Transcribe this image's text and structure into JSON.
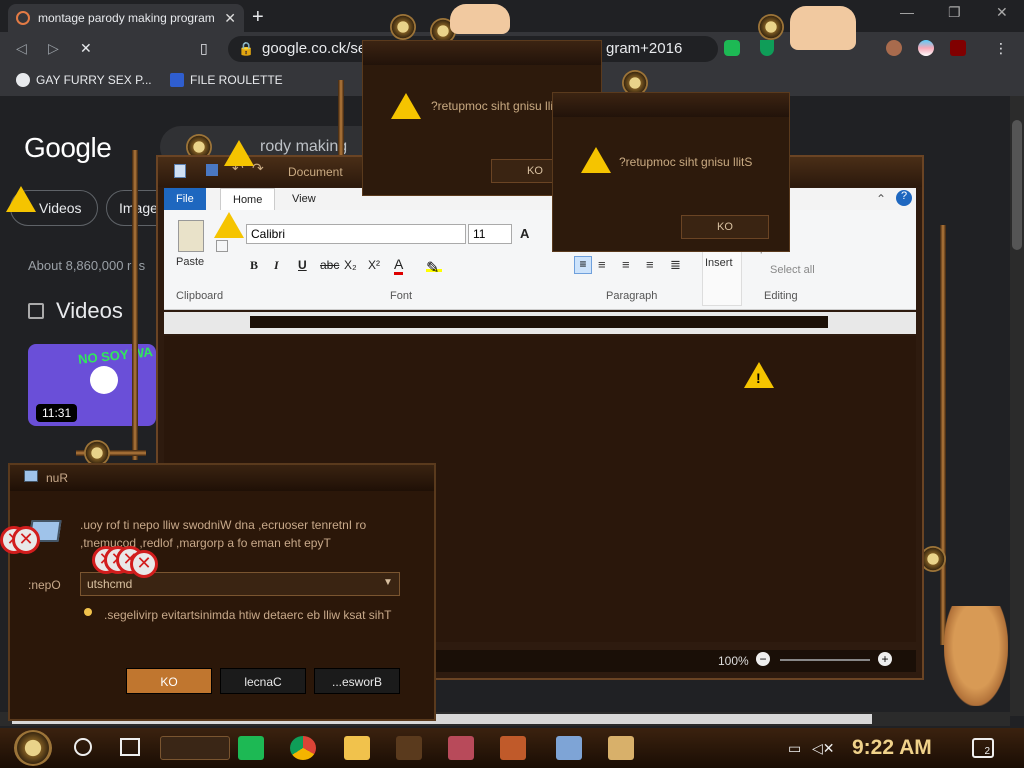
{
  "browser": {
    "tab_title": "montage parody making program",
    "new_tab": "+",
    "url": "google.co.ck/se",
    "url_tail": "gram+2016",
    "bookmarks": [
      {
        "label": "GAY FURRY SEX P..."
      },
      {
        "label": "FILE ROULETTE"
      }
    ]
  },
  "google": {
    "logo": "Google",
    "query": "rody making program 2016",
    "chips": [
      "Videos",
      "Images"
    ],
    "about": "About 8,860,000 res",
    "videos_heading": "Videos",
    "video_duration": "11:31",
    "video_overlay": "NO SOY WA"
  },
  "wordpad": {
    "title": "Document",
    "tabs": [
      "File",
      "Home",
      "View"
    ],
    "font_name": "Calibri",
    "font_size": "11",
    "format_buttons": [
      "B",
      "I",
      "U",
      "abc",
      "X₂",
      "X²"
    ],
    "groups": {
      "clipboard": "Clipboard",
      "font": "Font",
      "paragraph": "Paragraph",
      "editing": "Editing"
    },
    "paste_label": "Paste",
    "insert_label": "Insert",
    "replace_label": "place",
    "select_all_label": "Select all",
    "zoom": "100%"
  },
  "run_dialog": {
    "title": "nuR",
    "desc_line1": ".uoy rof ti nepo lliw swodniW dna ,ecruoser tenretnI ro",
    "desc_line2": ",tnemucod ,redlof ,margorp a fo eman eht epyT",
    "open_label": ":nepO",
    "input_value": "utshcmd",
    "admin_note": ".segelivirp evitartsinimda htiw detaerc eb lliw ksat sihT",
    "buttons": {
      "ok": "KO",
      "cancel": "lecnaC",
      "browse": "...esworB"
    }
  },
  "message_boxes": [
    {
      "text": "?retupmoc siht gnisu llit",
      "button": "KO"
    },
    {
      "text": "?retupmoc siht gnisu llitS",
      "button": "KO"
    }
  ],
  "taskbar": {
    "clock": "9:22 AM",
    "notification_count": "2"
  },
  "colors": {
    "brass": "#b57b3c",
    "dark_wood": "#2b1709",
    "text_brass": "#c9aa82",
    "ribbon_blue": "#1e67bf",
    "warning": "#f5c400",
    "error_red": "#d21d1d"
  }
}
